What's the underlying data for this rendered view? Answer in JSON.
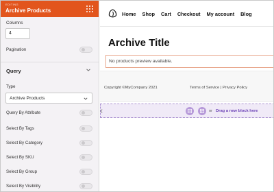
{
  "panel": {
    "kicker": "EDITING",
    "title": "Archive Products",
    "columns_label": "Columns",
    "columns_value": "4",
    "pagination_label": "Pagination",
    "query_section_title": "Query",
    "type_label": "Type",
    "type_value": "Archive Products",
    "options": [
      {
        "label": "Query By Attribute"
      },
      {
        "label": "Select By Tags"
      },
      {
        "label": "Select By Category"
      },
      {
        "label": "Select By SKU"
      },
      {
        "label": "Select By Group"
      },
      {
        "label": "Select By Visibility"
      }
    ]
  },
  "site": {
    "nav": [
      "Home",
      "Shop",
      "Cart",
      "Checkout",
      "My account",
      "Blog"
    ],
    "archive_title": "Archive Title",
    "notice": "No products preview available.",
    "copyright": "Copyright ©MyCompany 2021",
    "footer_terms": "Terms of Service",
    "footer_sep": " | ",
    "footer_privacy": "Privacy Policy"
  },
  "dropzone": {
    "or_text": "or",
    "drag_label": "Drag a new block here"
  },
  "colors": {
    "header_accent": "#e2551d",
    "dropzone_accent": "#6a3fb5",
    "dropzone_button": "#b79ad9"
  }
}
